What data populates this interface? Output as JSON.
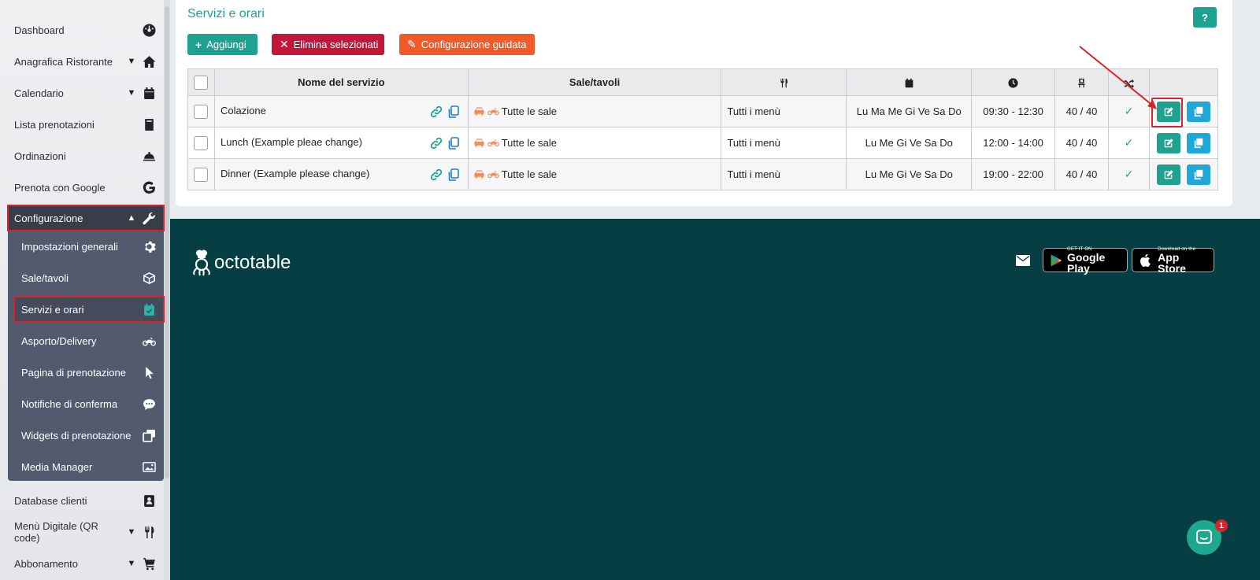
{
  "sidebar": {
    "items": [
      {
        "label": "Dashboard",
        "icon": "dashboard-icon"
      },
      {
        "label": "Anagrafica Ristorante",
        "icon": "home-icon",
        "chevron": "down"
      },
      {
        "label": "Calendario",
        "icon": "calendar-icon",
        "chevron": "down"
      },
      {
        "label": "Lista prenotazioni",
        "icon": "book-icon"
      },
      {
        "label": "Ordinazioni",
        "icon": "bell-icon"
      },
      {
        "label": "Prenota con Google",
        "icon": "google-icon"
      },
      {
        "label": "Configurazione",
        "icon": "wrench-icon",
        "chevron": "up"
      },
      {
        "label": "Database clienti",
        "icon": "contact-book-icon"
      },
      {
        "label": "Menù Digitale (QR code)",
        "icon": "cutlery-icon",
        "chevron": "down"
      },
      {
        "label": "Abbonamento",
        "icon": "cart-icon",
        "chevron": "down"
      }
    ],
    "submenu": [
      {
        "label": "Impostazioni generali",
        "icon": "gear-icon"
      },
      {
        "label": "Sale/tavoli",
        "icon": "cube-icon"
      },
      {
        "label": "Servizi e orari",
        "icon": "calendar-check-icon"
      },
      {
        "label": "Asporto/Delivery",
        "icon": "motorbike-icon"
      },
      {
        "label": "Pagina di prenotazione",
        "icon": "cursor-icon"
      },
      {
        "label": "Notifiche di conferma",
        "icon": "chat-icon"
      },
      {
        "label": "Widgets di prenotazione",
        "icon": "widgets-icon"
      },
      {
        "label": "Media Manager",
        "icon": "image-icon"
      }
    ]
  },
  "page": {
    "title": "Servizi e orari",
    "help_label": "?"
  },
  "toolbar": {
    "add_label": "Aggiungi",
    "delete_label": "Elimina selezionati",
    "wizard_label": "Configurazione guidata"
  },
  "table": {
    "headers": {
      "name": "Nome del servizio",
      "rooms": "Sale/tavoli"
    },
    "rows": [
      {
        "name": "Colazione",
        "rooms": "Tutte le sale",
        "menu": "Tutti i menù",
        "days": "Lu Ma Me Gi Ve Sa Do",
        "hours": "09:30 - 12:30",
        "covers": "40 / 40"
      },
      {
        "name": "Lunch (Example pleae change)",
        "rooms": "Tutte le sale",
        "menu": "Tutti i menù",
        "days": "Lu Me Gi Ve Sa Do",
        "hours": "12:00 - 14:00",
        "covers": "40 / 40"
      },
      {
        "name": "Dinner (Example please change)",
        "rooms": "Tutte le sale",
        "menu": "Tutti i menù",
        "days": "Lu Me Gi Ve Sa Do",
        "hours": "19:00 - 22:00",
        "covers": "40 / 40"
      }
    ]
  },
  "footer": {
    "logo_text": "octotable",
    "google_play_small": "GET IT ON",
    "google_play_big": "Google Play",
    "app_store_small": "Download on the",
    "app_store_big": "App Store"
  },
  "chat": {
    "badge": "1"
  },
  "colors": {
    "brand": "#1fa190",
    "danger": "#c2173b",
    "warning": "#f15b2a",
    "info": "#1ea8d9",
    "footer": "#053f44",
    "highlight": "#d8232a"
  }
}
